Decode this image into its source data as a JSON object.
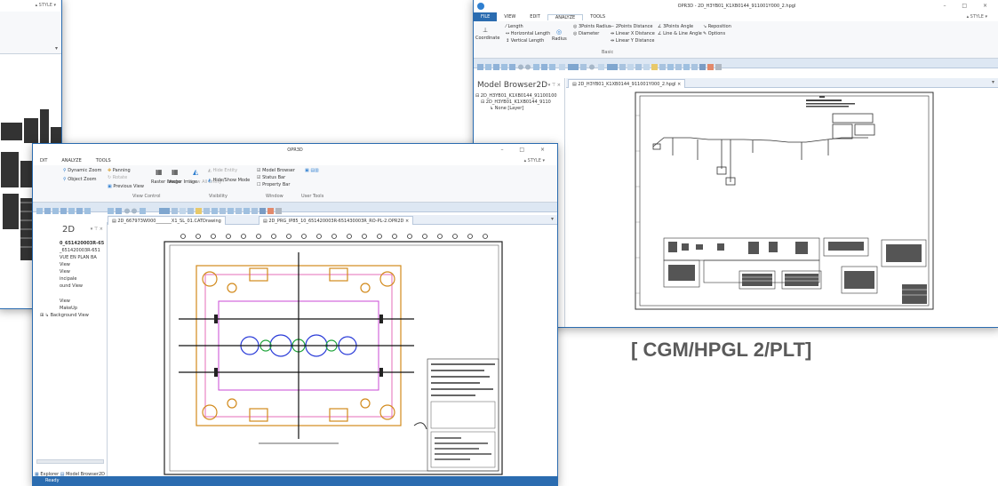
{
  "caption": "[ CGM/HPGL 2/PLT]",
  "win_back": {
    "style_label": "▴ STYLE ▾"
  },
  "win_right": {
    "title": "OPR3D - 2D_H3YB01_K1XB0144_911001Y000_2.hpgl",
    "menu": [
      "FILE",
      "VIEW",
      "EDIT",
      "ANALYZE",
      "TOOLS"
    ],
    "style_label": "▴ STYLE ▾",
    "ribbon": {
      "coordinate": "Coordinate",
      "length": "Length",
      "horizontal_length": "Horizontal Length",
      "vertical_length": "Vertical Length",
      "radius": "Radius",
      "three_points_radius": "3Points Radius",
      "diameter": "Diameter",
      "two_points_distance": "2Points Distance",
      "linear_x_distance": "Linear X Distance",
      "linear_y_distance": "Linear Y Distance",
      "three_points_angle": "3Points Angle",
      "line_line_angle": "Line & Line Angle",
      "reposition": "Reposition",
      "options": "Options",
      "group_basic": "Basic"
    },
    "panel_title": "Model Browser2D",
    "tab_label": "2D_H3YB01_K1XB0144_911001Y000_2.hpgl",
    "tree": [
      "2D_H3YB01_K1XB0144_91100100",
      "2D_H3YB01_K1XB0144_9110",
      "None [Layer]"
    ]
  },
  "win_front": {
    "title": "OPR3D",
    "menu": [
      "DIT",
      "ANALYZE",
      "TOOLS"
    ],
    "style_label": "▴ STYLE ▾",
    "ribbon": {
      "dynamic_zoom": "Dynamic Zoom",
      "object_zoom": "Object Zoom",
      "panning": "Panning",
      "rotate": "Rotate",
      "previous_view": "Previous View",
      "raster_image": "Raster Image",
      "vector_image": "Vector Image",
      "show_all_entity": "Show All Entity",
      "hide_entity": "Hide Entity",
      "hide_show_mode": "Hide/Show Mode",
      "model_browser": "Model Browser",
      "status_bar": "Status Bar",
      "property_bar": "Property Bar",
      "group_view_control": "View Control",
      "group_visibility": "Visibility",
      "group_window": "Window",
      "group_user_tools": "User Tools"
    },
    "panel_title": "2D",
    "tabs": [
      "2D_667973W000_______X1_SL_01.CATDrawing",
      "2D_PRG_IP85_10_651420003R-651430003R_RO-PL-2.OPR2D"
    ],
    "tree": [
      "0_651420003R-65",
      "_651420003R-651",
      "VUE EN PLAN BA",
      "View",
      "View",
      "incipale",
      "ound View",
      "View",
      "MakeUp",
      "Background View"
    ],
    "bottom_tabs": [
      "Explorer",
      "Model Browser2D"
    ],
    "status": "Ready"
  }
}
